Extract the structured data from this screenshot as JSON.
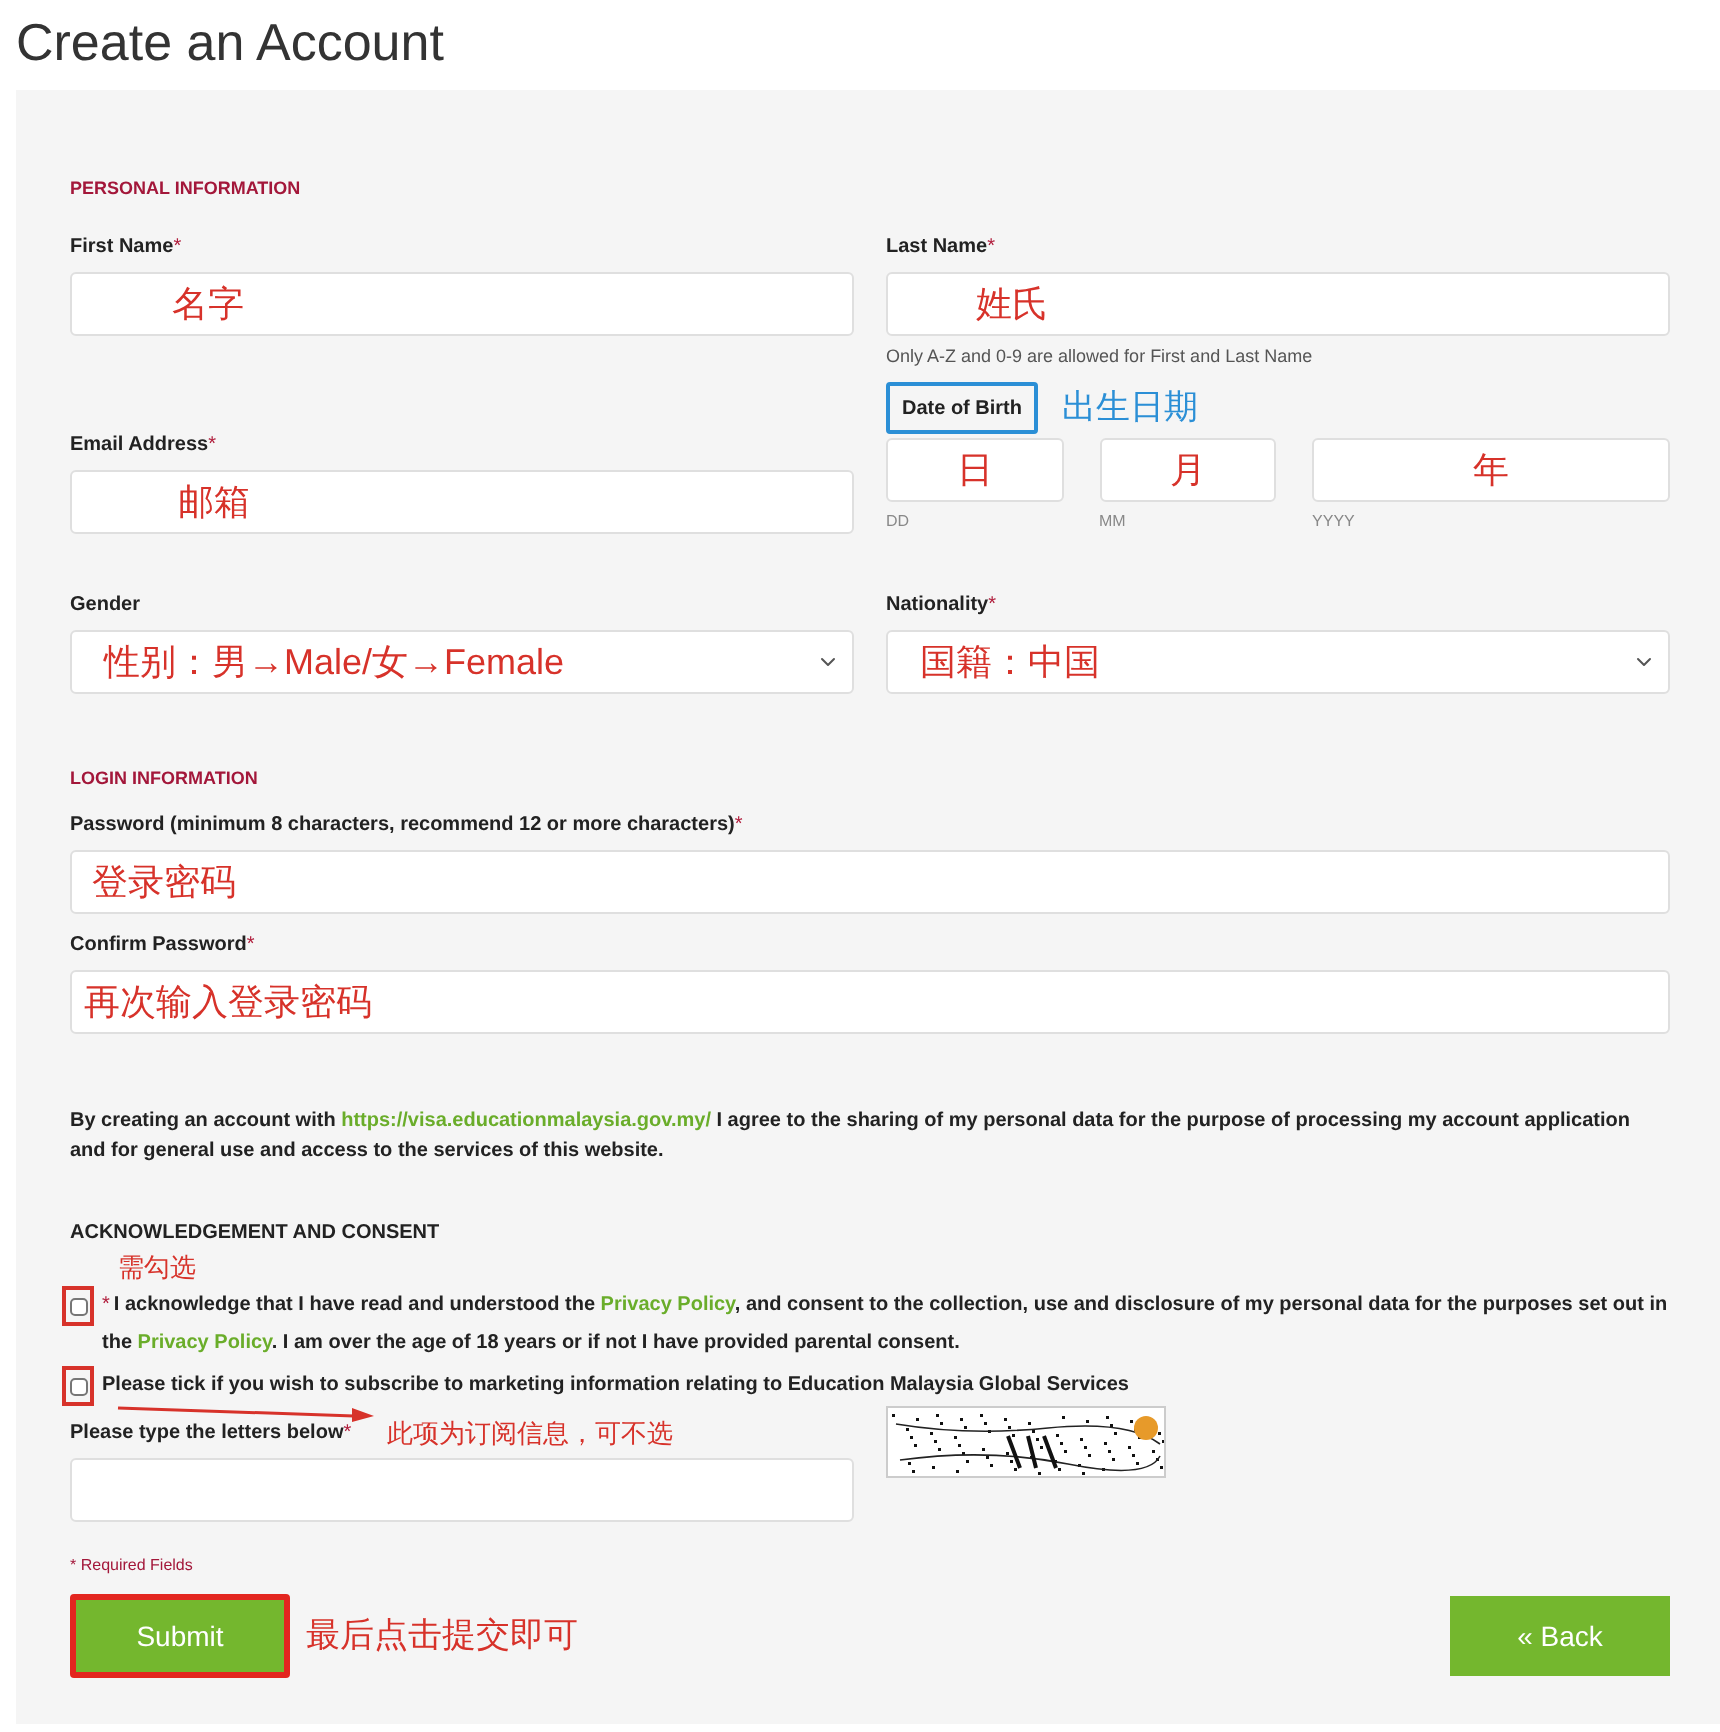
{
  "title": "Create an Account",
  "personal": {
    "heading": "PERSONAL INFORMATION",
    "first_name": {
      "label": "First Name",
      "required_mark": "*",
      "value": "名字"
    },
    "last_name": {
      "label": "Last Name",
      "required_mark": "*",
      "value": "姓氏",
      "hint": "Only A-Z and 0-9 are allowed for First and Last Name"
    },
    "email": {
      "label": "Email Address",
      "required_mark": "*",
      "value": "邮箱"
    },
    "dob": {
      "label": "Date of Birth",
      "highlighted": true,
      "note": "出生日期",
      "parts": [
        {
          "value": "日",
          "hint": "DD"
        },
        {
          "value": "月",
          "hint": "MM"
        },
        {
          "value": "年",
          "hint": "YYYY"
        }
      ]
    },
    "gender": {
      "label": "Gender",
      "value": "性别：男→Male/女→Female"
    },
    "nationality": {
      "label": "Nationality",
      "required_mark": "*",
      "value": "国籍：中国"
    }
  },
  "login": {
    "heading": "LOGIN INFORMATION",
    "password": {
      "label": "Password (minimum 8 characters, recommend 12 or more characters)",
      "required_mark": "*",
      "value": "登录密码"
    },
    "confirm_password": {
      "label": "Confirm Password",
      "required_mark": "*",
      "value": "再次输入登录密码"
    }
  },
  "agreement": {
    "before": "By creating an account with ",
    "link": "https://visa.educationmalaysia.gov.my/",
    "after": " I agree to the sharing of my personal data for the purpose of processing my account application and for general use and access to the services of this website."
  },
  "consent": {
    "heading": "ACKNOWLEDGEMENT AND CONSENT",
    "note": "需勾选",
    "items": [
      {
        "checked": false,
        "highlighted": true,
        "required_mark": "*",
        "segments": [
          {
            "kind": "text",
            "text": "I acknowledge that I have read and understood the "
          },
          {
            "kind": "link",
            "text": "Privacy Policy"
          },
          {
            "kind": "text",
            "text": ", and consent to the collection, use and disclosure of my personal data for the purposes set out in the "
          },
          {
            "kind": "link",
            "text": "Privacy Policy"
          },
          {
            "kind": "text",
            "text": ". I am over the age of 18 years or if not I have provided parental consent."
          }
        ]
      },
      {
        "checked": false,
        "highlighted": true,
        "segments": [
          {
            "kind": "text",
            "text": "Please tick if you wish to subscribe to marketing information relating to Education Malaysia Global Services"
          }
        ]
      }
    ],
    "subscribe_note": "此项为订阅信息，可不选"
  },
  "captcha": {
    "label": "Please type the letters below",
    "required_mark": "*"
  },
  "required_note": "* Required Fields",
  "submit": {
    "label": "Submit",
    "highlighted": true,
    "note": "最后点击提交即可"
  },
  "back": {
    "label": "« Back"
  }
}
